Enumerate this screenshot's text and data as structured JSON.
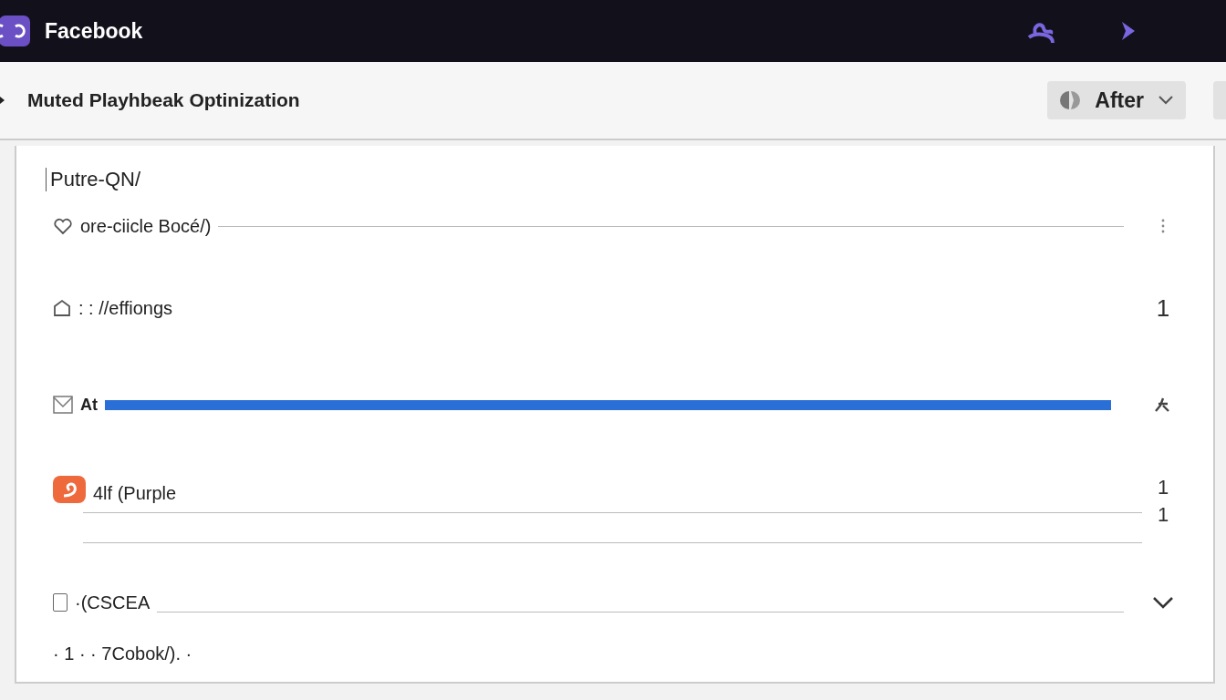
{
  "topbar": {
    "brand": "Facebook"
  },
  "header": {
    "title": "Muted Playhbeak Optinization",
    "dropdown": {
      "label": "After"
    }
  },
  "panel": {
    "heading": "Putre-QN/",
    "rows": [
      {
        "kind": "line",
        "label": "ore-ciicle Bocé/)"
      },
      {
        "kind": "plain",
        "label": ": : //effiongs",
        "value": "1"
      },
      {
        "kind": "progress",
        "label": "At",
        "level": 1
      },
      {
        "kind": "double",
        "label": "4lf (Purple",
        "values": [
          "1",
          "1"
        ]
      },
      {
        "kind": "check",
        "checked": false,
        "label": "·(CSCEA"
      },
      {
        "kind": "cut",
        "label": "· 1 · · 7Cobok/). ·"
      }
    ]
  }
}
